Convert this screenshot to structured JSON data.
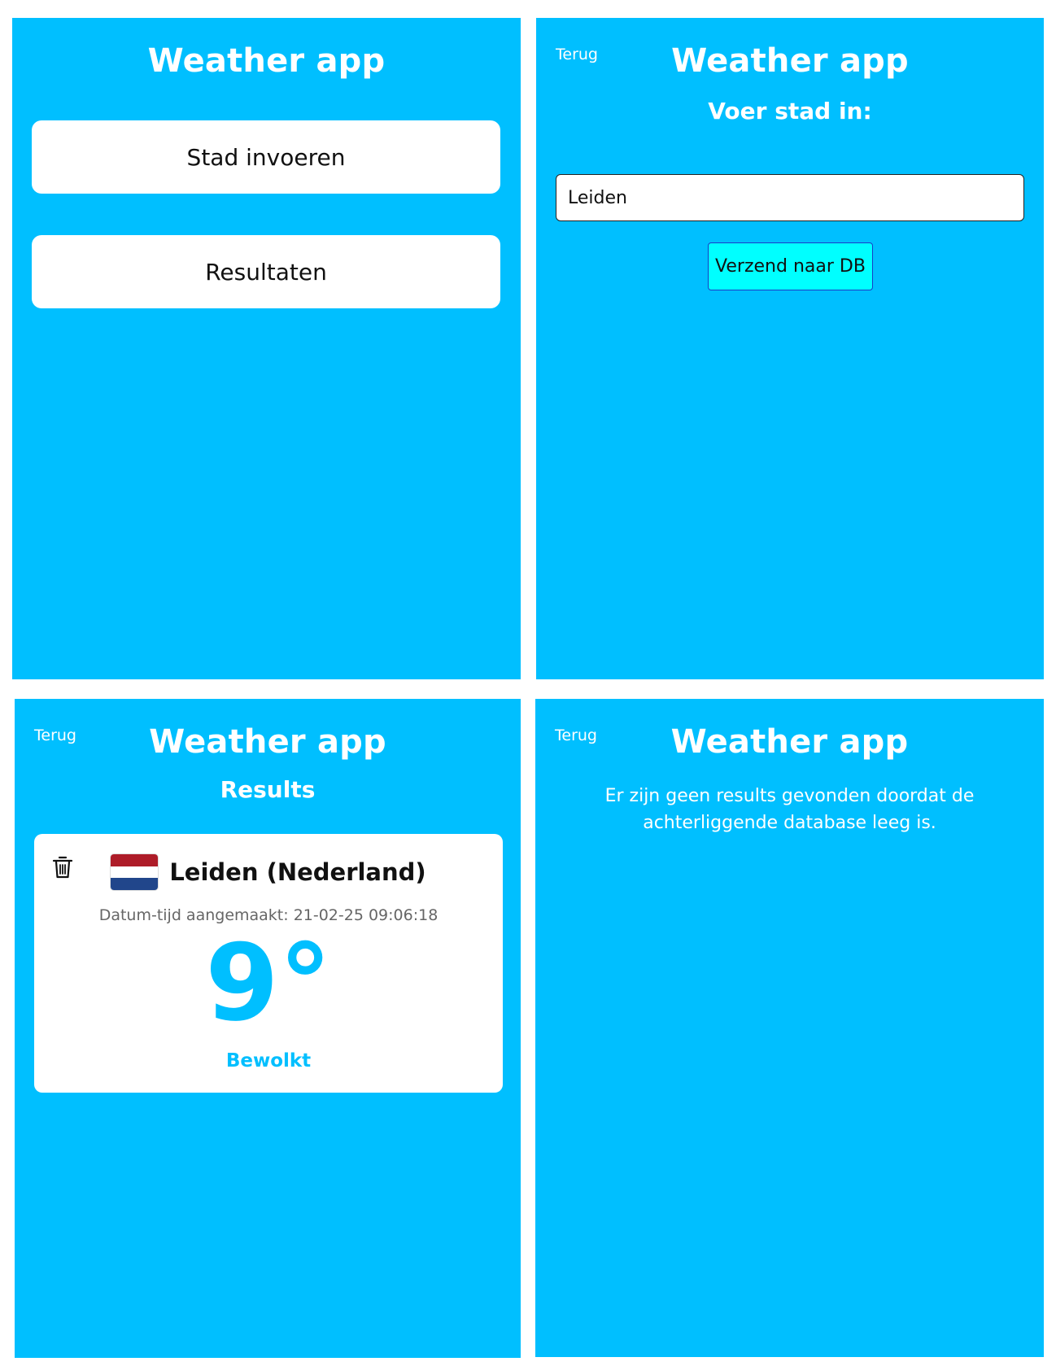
{
  "colors": {
    "background": "#00bfff",
    "card": "#ffffff",
    "accent": "#00bfff",
    "submit_button": "#00ffff",
    "submit_border": "#1a3cc7"
  },
  "home": {
    "title": "Weather app",
    "buttons": [
      {
        "label": "Stad invoeren"
      },
      {
        "label": "Resultaten"
      }
    ]
  },
  "input_screen": {
    "back_label": "Terug",
    "title": "Weather app",
    "prompt": "Voer stad in:",
    "city_value": "Leiden",
    "submit_label": "Verzend naar DB"
  },
  "results_screen": {
    "back_label": "Terug",
    "title": "Weather app",
    "heading": "Results",
    "results": [
      {
        "icon": "trash-icon",
        "flag": "netherlands-flag",
        "flag_colors": [
          "#ae1c28",
          "#ffffff",
          "#21468b"
        ],
        "city": "Leiden (Nederland)",
        "created": "Datum-tijd aangemaakt: 21-02-25 09:06:18",
        "temperature": "9°",
        "condition": "Bewolkt"
      }
    ]
  },
  "empty_screen": {
    "back_label": "Terug",
    "title": "Weather app",
    "message": "Er zijn geen results gevonden doordat de achterliggende database leeg is."
  }
}
